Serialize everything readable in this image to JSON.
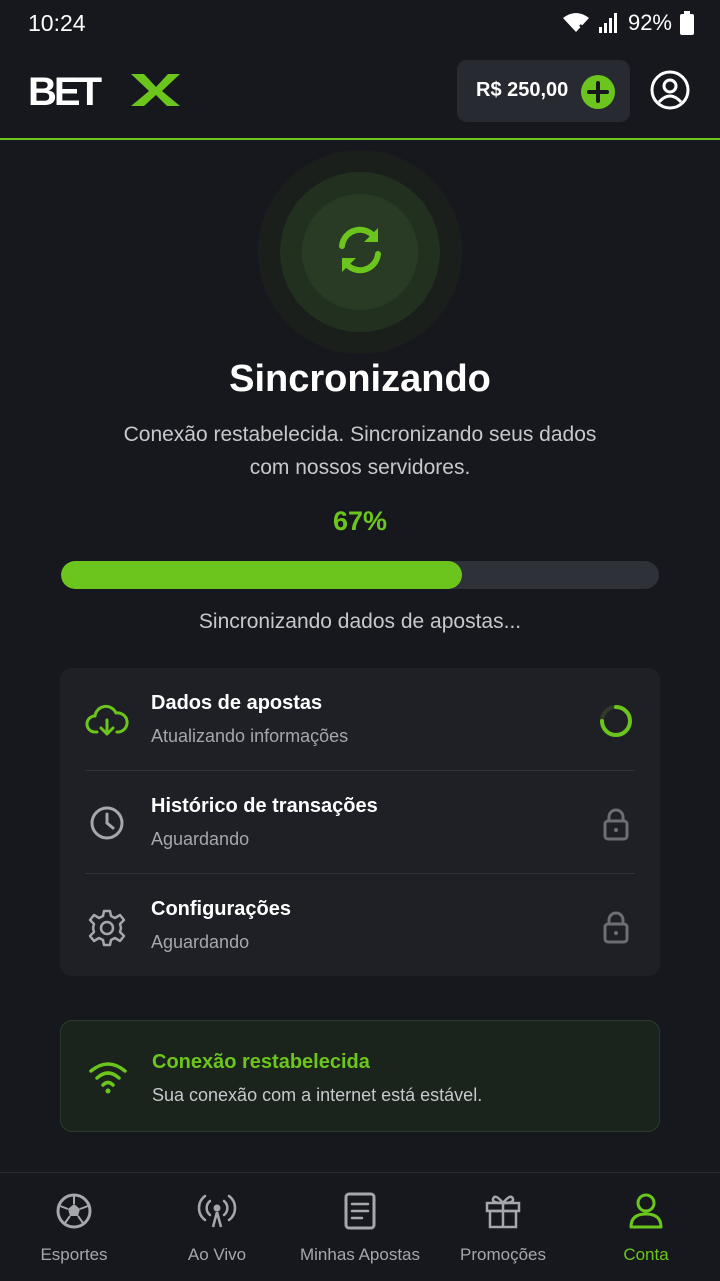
{
  "status_bar": {
    "time": "10:24",
    "battery": "92%"
  },
  "header": {
    "logo_text": "BETX",
    "balance": "R$ 250,00",
    "add_icon": "plus-icon",
    "profile_icon": "user-circle-icon"
  },
  "sync": {
    "icon": "refresh-icon",
    "title": "Sincronizando",
    "subtitle": "Conexão restabelecida. Sincronizando seus dados com nossos servidores.",
    "percent_label": "67%",
    "progress": 0.67,
    "status_text": "Sincronizando dados de apostas..."
  },
  "tasks": [
    {
      "title": "Dados de apostas",
      "subtitle": "Atualizando informações",
      "icon": "cloud-download-icon",
      "status": "loading"
    },
    {
      "title": "Histórico de transações",
      "subtitle": "Aguardando",
      "icon": "clock-icon",
      "status": "locked"
    },
    {
      "title": "Configurações",
      "subtitle": "Aguardando",
      "icon": "gear-icon",
      "status": "locked"
    }
  ],
  "connection": {
    "title": "Conexão restabelecida",
    "subtitle": "Sua conexão com a internet está estável.",
    "icon": "wifi-icon"
  },
  "nav": [
    {
      "label": "Esportes",
      "icon": "soccer-ball-icon",
      "active": false
    },
    {
      "label": "Ao Vivo",
      "icon": "broadcast-icon",
      "active": false
    },
    {
      "label": "Minhas Apostas",
      "icon": "document-icon",
      "active": false
    },
    {
      "label": "Promoções",
      "icon": "gift-icon",
      "active": false
    },
    {
      "label": "Conta",
      "icon": "user-icon",
      "active": true
    }
  ],
  "colors": {
    "accent": "#6cc51c",
    "background": "#16181d",
    "card": "#1e2026"
  }
}
